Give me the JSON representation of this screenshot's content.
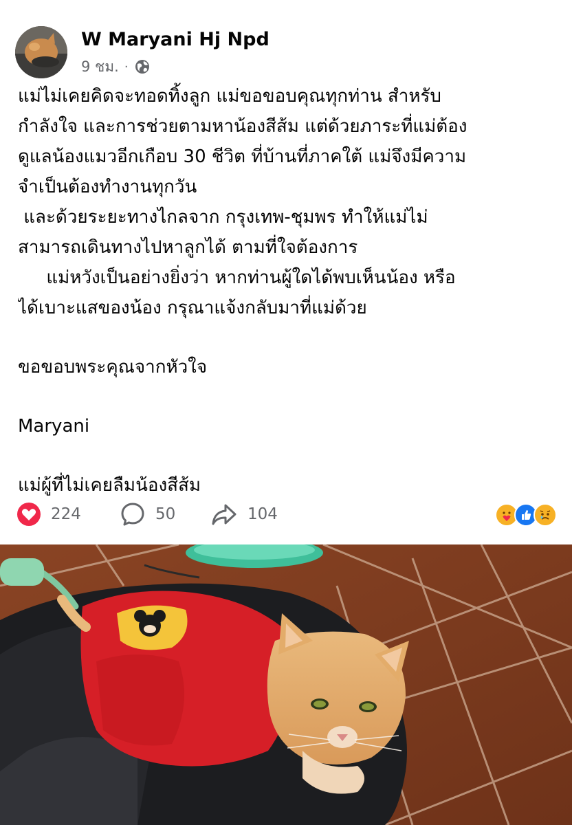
{
  "post": {
    "author": "W Maryani Hj Npd",
    "time": "9 ชม.",
    "separator": "·",
    "privacy_icon": "globe-icon",
    "text_lines": [
      "แม่ไม่เคยคิดจะทอดทิ้งลูก แม่ขอขอบคุณทุกท่าน สำหรับ",
      "กำลังใจ และการช่วยตามหาน้องสีส้ม แต่ด้วยภาระที่แม่ต้อง",
      "ดูแลน้องแมวอีกเกือบ 30 ชีวิต ที่บ้านที่ภาคใต้ แม่จึงมีความ",
      "จำเป็นต้องทำงานทุกวัน",
      " และด้วยระยะทางไกลจาก กรุงเทพ-ชุมพร ทำให้แม่ไม่",
      "สามารถเดินทางไปหาลูกได้ ตามที่ใจต้องการ",
      "     แม่หวังเป็นอย่างยิ่งว่า หากท่านผู้ใดได้พบเห็นน้อง หรือ",
      "ได้เบาะแสของน้อง กรุณาแจ้งกลับมาที่แม่ด้วย"
    ],
    "thanks": "ขอขอบพระคุณจากหัวใจ",
    "signature": "Maryani",
    "closing": "แม่ผู้ที่ไม่เคยลืมน้องสีส้ม"
  },
  "stats": {
    "likes": "224",
    "comments": "50",
    "shares": "104",
    "reaction_icons": [
      "care-icon",
      "like-icon",
      "sad-icon"
    ]
  },
  "colors": {
    "heart": "#f0284a",
    "meta_gray": "#65676b",
    "like_blue": "#1877f2",
    "reaction_yellow": "#f7b125"
  }
}
